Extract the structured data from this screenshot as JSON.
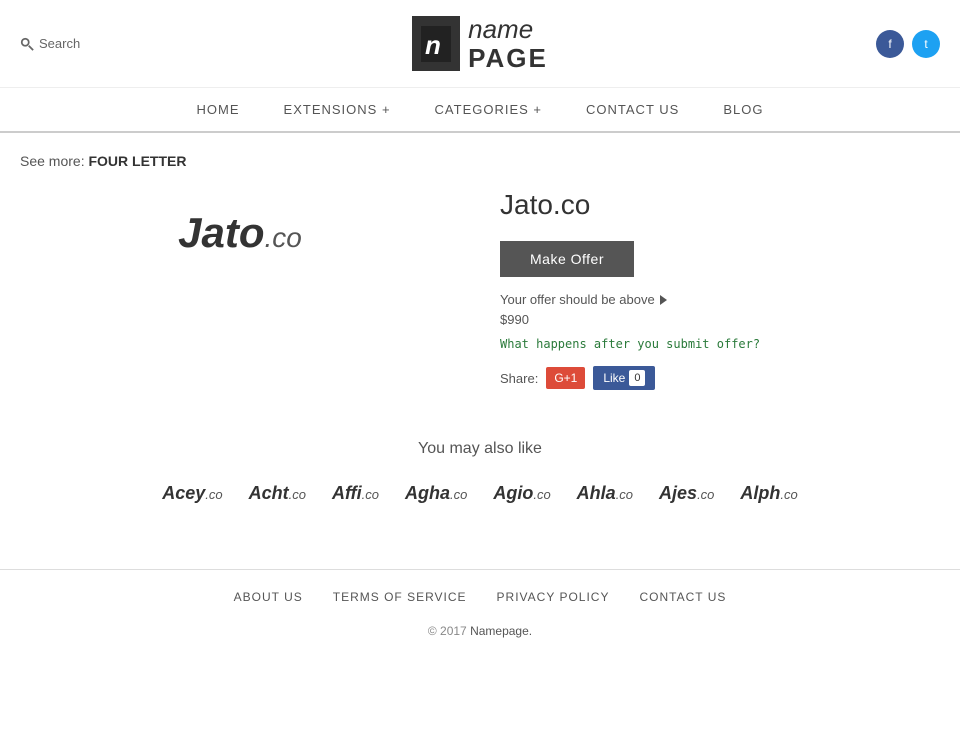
{
  "header": {
    "search_label": "Search",
    "logo_icon": "n",
    "logo_name": "name",
    "logo_page": "PAGE",
    "social": {
      "facebook_label": "f",
      "twitter_label": "t"
    }
  },
  "nav": {
    "items": [
      {
        "label": "HOME",
        "id": "home"
      },
      {
        "label": "EXTENSIONS +",
        "id": "extensions"
      },
      {
        "label": "CATEGORIES +",
        "id": "categories"
      },
      {
        "label": "CONTACT US",
        "id": "contact"
      },
      {
        "label": "BLOG",
        "id": "blog"
      }
    ]
  },
  "breadcrumb": {
    "see_more_label": "See more:",
    "link_label": "FOUR LETTER"
  },
  "product": {
    "name": "Jato",
    "extension": ".co",
    "full_name": "Jato.co",
    "make_offer_label": "Make Offer",
    "offer_hint": "Your offer should be above",
    "offer_price": "$990",
    "offer_link_text": "What happens after you submit offer?",
    "share_label": "Share:",
    "gplus_label": "G+1",
    "fb_label": "Like",
    "fb_count": "0"
  },
  "also_like": {
    "title": "You may also like",
    "domains": [
      {
        "name": "Acey",
        "ext": ".co"
      },
      {
        "name": "Acht",
        "ext": ".co"
      },
      {
        "name": "Affi",
        "ext": ".co"
      },
      {
        "name": "Agha",
        "ext": ".co"
      },
      {
        "name": "Agio",
        "ext": ".co"
      },
      {
        "name": "Ahla",
        "ext": ".co"
      },
      {
        "name": "Ajes",
        "ext": ".co"
      },
      {
        "name": "Alph",
        "ext": ".co"
      }
    ]
  },
  "footer": {
    "links": [
      {
        "label": "ABOUT US",
        "id": "about"
      },
      {
        "label": "TERMS OF SERVICE",
        "id": "terms"
      },
      {
        "label": "PRIVACY POLICY",
        "id": "privacy"
      },
      {
        "label": "CONTACT US",
        "id": "contact"
      }
    ],
    "copy": "© 2017",
    "brand": "Namepage."
  }
}
